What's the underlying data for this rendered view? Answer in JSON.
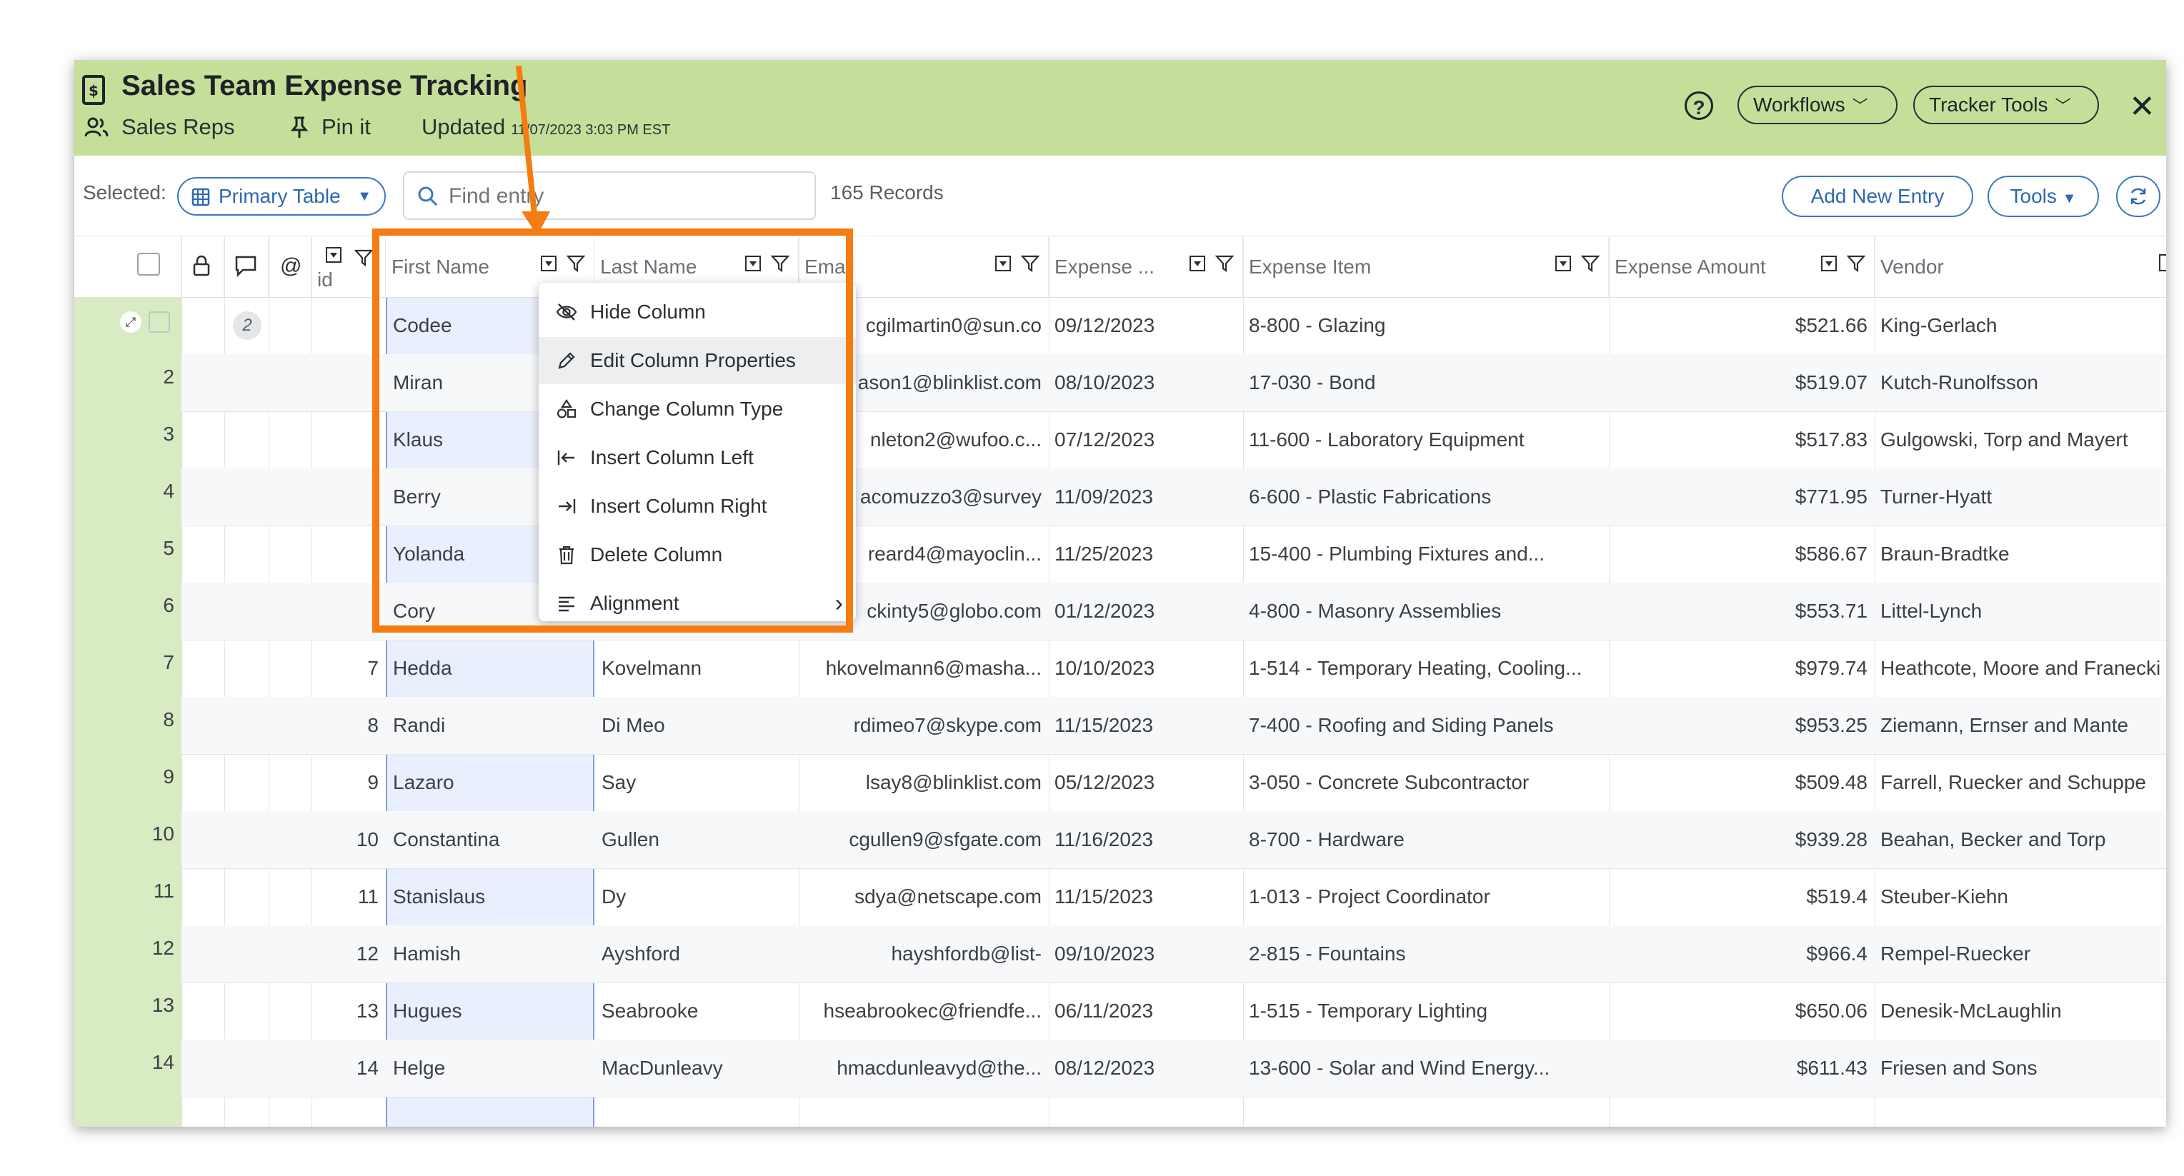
{
  "header": {
    "title": "Sales Team Expense Tracking",
    "sub_group": "Sales Reps",
    "pin_label": "Pin it",
    "updated_label": "Updated",
    "updated_time": "11/07/2023 3:03 PM EST",
    "help": "?",
    "workflows_label": "Workflows",
    "tracker_tools_label": "Tracker Tools",
    "close": "✕"
  },
  "toolbar": {
    "selected_label": "Selected:",
    "table_select": "Primary Table",
    "search_placeholder": "Find entry",
    "records": "165 Records",
    "add_label": "Add New Entry",
    "tools_label": "Tools"
  },
  "columns": {
    "id": "id",
    "first_name": "First Name",
    "last_name": "Last Name",
    "email": "Email",
    "expense_date": "Expense ...",
    "expense_item": "Expense Item",
    "expense_amount": "Expense Amount",
    "vendor": "Vendor"
  },
  "comment_badge": "2",
  "context_menu": [
    {
      "label": "Hide Column",
      "icon": "eye-off-icon"
    },
    {
      "label": "Edit Column Properties",
      "icon": "pencil-icon"
    },
    {
      "label": "Change Column Type",
      "icon": "shapes-icon"
    },
    {
      "label": "Insert Column Left",
      "icon": "arrow-left-bar-icon"
    },
    {
      "label": "Insert Column Right",
      "icon": "arrow-right-bar-icon"
    },
    {
      "label": "Delete Column",
      "icon": "trash-icon"
    },
    {
      "label": "Alignment",
      "icon": "align-left-icon"
    }
  ],
  "rows": [
    {
      "num": "",
      "id": "",
      "first": "Codee",
      "last": "",
      "email": "cgilmartin0@sun.co",
      "date": "09/12/2023",
      "item": "8-800 - Glazing",
      "amount": "$521.66",
      "vendor": "King-Gerlach"
    },
    {
      "num": "2",
      "id": "",
      "first": "Miran",
      "last": "",
      "email": "ason1@blinklist.com",
      "date": "08/10/2023",
      "item": "17-030 - Bond",
      "amount": "$519.07",
      "vendor": "Kutch-Runolfsson"
    },
    {
      "num": "3",
      "id": "",
      "first": "Klaus",
      "last": "",
      "email": "nleton2@wufoo.c...",
      "date": "07/12/2023",
      "item": "11-600 - Laboratory Equipment",
      "amount": "$517.83",
      "vendor": "Gulgowski, Torp and Mayert"
    },
    {
      "num": "4",
      "id": "",
      "first": "Berry",
      "last": "",
      "email": "acomuzzo3@survey",
      "date": "11/09/2023",
      "item": "6-600 - Plastic Fabrications",
      "amount": "$771.95",
      "vendor": "Turner-Hyatt"
    },
    {
      "num": "5",
      "id": "",
      "first": "Yolanda",
      "last": "",
      "email": "reard4@mayoclin...",
      "date": "11/25/2023",
      "item": "15-400 - Plumbing Fixtures and...",
      "amount": "$586.67",
      "vendor": "Braun-Bradtke"
    },
    {
      "num": "6",
      "id": "",
      "first": "Cory",
      "last": "",
      "email": "ckinty5@globo.com",
      "date": "01/12/2023",
      "item": "4-800 - Masonry Assemblies",
      "amount": "$553.71",
      "vendor": "Littel-Lynch"
    },
    {
      "num": "7",
      "id": "7",
      "first": "Hedda",
      "last": "Kovelmann",
      "email": "hkovelmann6@masha...",
      "date": "10/10/2023",
      "item": "1-514 - Temporary Heating, Cooling...",
      "amount": "$979.74",
      "vendor": "Heathcote, Moore and Franecki"
    },
    {
      "num": "8",
      "id": "8",
      "first": "Randi",
      "last": "Di Meo",
      "email": "rdimeo7@skype.com",
      "date": "11/15/2023",
      "item": "7-400 - Roofing and Siding Panels",
      "amount": "$953.25",
      "vendor": "Ziemann, Ernser and Mante"
    },
    {
      "num": "9",
      "id": "9",
      "first": "Lazaro",
      "last": "Say",
      "email": "lsay8@blinklist.com",
      "date": "05/12/2023",
      "item": "3-050 - Concrete Subcontractor",
      "amount": "$509.48",
      "vendor": "Farrell, Ruecker and Schuppe"
    },
    {
      "num": "10",
      "id": "10",
      "first": "Constantina",
      "last": "Gullen",
      "email": "cgullen9@sfgate.com",
      "date": "11/16/2023",
      "item": "8-700 - Hardware",
      "amount": "$939.28",
      "vendor": "Beahan, Becker and Torp"
    },
    {
      "num": "11",
      "id": "11",
      "first": "Stanislaus",
      "last": "Dy",
      "email": "sdya@netscape.com",
      "date": "11/15/2023",
      "item": "1-013 - Project Coordinator",
      "amount": "$519.4",
      "vendor": "Steuber-Kiehn"
    },
    {
      "num": "12",
      "id": "12",
      "first": "Hamish",
      "last": "Ayshford",
      "email": "hayshfordb@list-",
      "date": "09/10/2023",
      "item": "2-815 - Fountains",
      "amount": "$966.4",
      "vendor": "Rempel-Ruecker"
    },
    {
      "num": "13",
      "id": "13",
      "first": "Hugues",
      "last": "Seabrooke",
      "email": "hseabrookec@friendfe...",
      "date": "06/11/2023",
      "item": "1-515 - Temporary Lighting",
      "amount": "$650.06",
      "vendor": "Denesik-McLaughlin"
    },
    {
      "num": "14",
      "id": "14",
      "first": "Helge",
      "last": "MacDunleavy",
      "email": "hmacdunleavyd@the...",
      "date": "08/12/2023",
      "item": "13-600 - Solar and Wind Energy...",
      "amount": "$611.43",
      "vendor": "Friesen and Sons"
    }
  ],
  "accent": "#f47c10",
  "header_bg": "#c5df9b",
  "link_blue": "#2d69b0"
}
